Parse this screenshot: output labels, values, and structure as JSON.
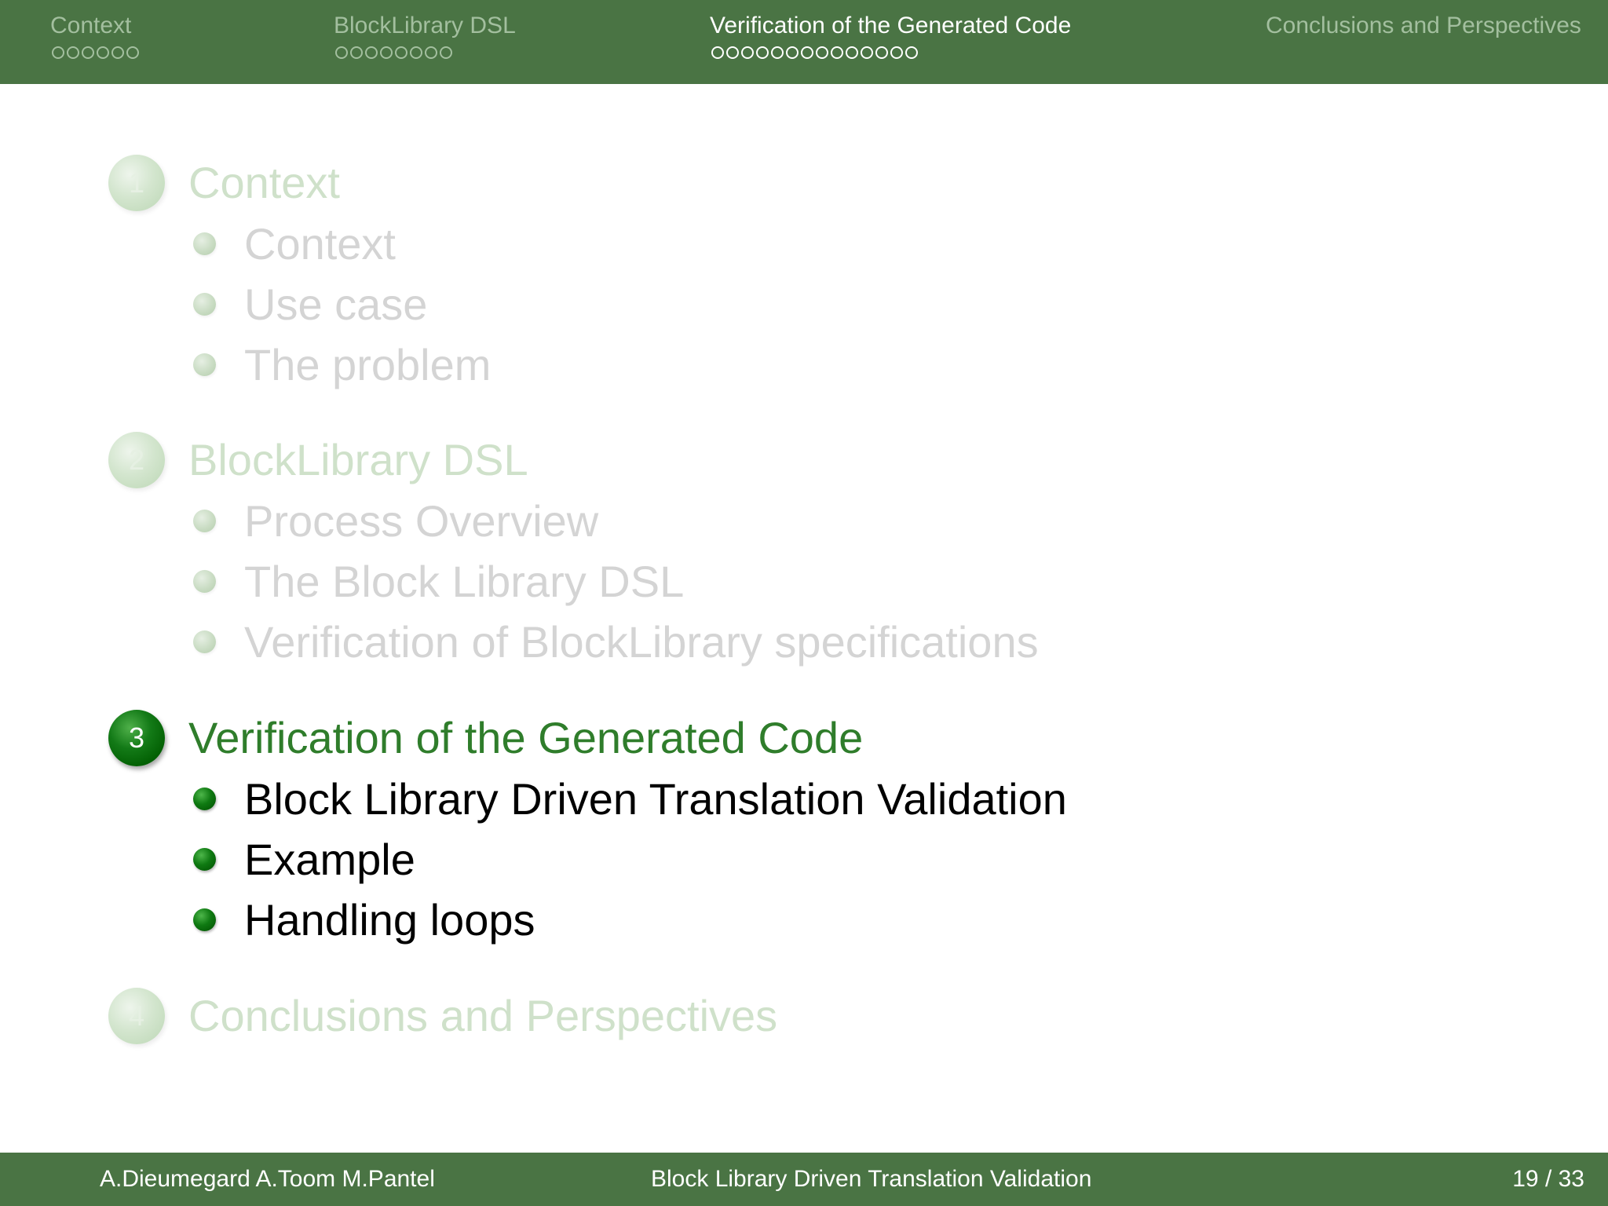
{
  "header": {
    "sections": [
      {
        "title": "Context",
        "dot_count": 6,
        "active": false
      },
      {
        "title": "BlockLibrary DSL",
        "dot_count": 8,
        "active": false
      },
      {
        "title": "Verification of the Generated Code",
        "dot_count": 14,
        "active": true
      },
      {
        "title": "Conclusions and Perspectives",
        "dot_count": 0,
        "active": false
      }
    ]
  },
  "toc": {
    "sections": [
      {
        "number": "1",
        "title": "Context",
        "current": false,
        "subsections": [
          "Context",
          "Use case",
          "The problem"
        ]
      },
      {
        "number": "2",
        "title": "BlockLibrary DSL",
        "current": false,
        "subsections": [
          "Process Overview",
          "The Block Library DSL",
          "Verification of BlockLibrary specifications"
        ]
      },
      {
        "number": "3",
        "title": "Verification of the Generated Code",
        "current": true,
        "subsections": [
          "Block Library Driven Translation Validation",
          "Example",
          "Handling loops"
        ]
      },
      {
        "number": "4",
        "title": "Conclusions and Perspectives",
        "current": false,
        "subsections": []
      }
    ]
  },
  "footer": {
    "authors": "A.Dieumegard A.Toom M.Pantel",
    "title": "Block Library Driven Translation Validation",
    "page": "19 / 33"
  },
  "colors": {
    "bar_background": "#4a7444",
    "inactive_nav_text": "#a3bf9f",
    "current_section_title": "#2f7d2b",
    "faded_section_title": "#cfe1ca",
    "faded_subsection": "#d4d4d4"
  }
}
